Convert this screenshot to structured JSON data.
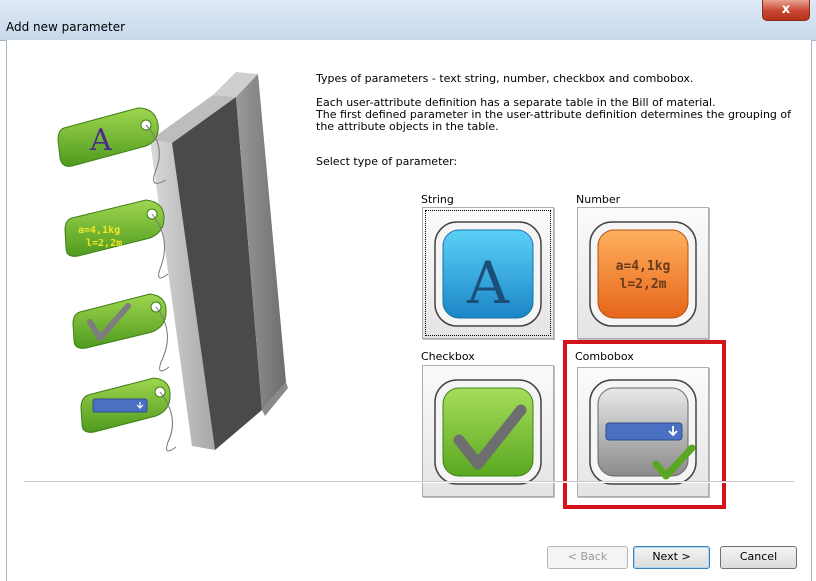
{
  "window": {
    "title": "Add new parameter",
    "close_label": "x"
  },
  "description": {
    "line1": "Types of parameters - text string, number, checkbox and combobox.",
    "line2": "Each user-attribute definition has a separate table in the Bill of material.",
    "line3": "The first defined parameter in the user-attribute definition determines the grouping of",
    "line4": "the attribute objects in the table.",
    "select_prompt": "Select type of parameter:"
  },
  "options": [
    {
      "label": "String",
      "icon": "A",
      "selected": false
    },
    {
      "label": "Number",
      "icon_line1": "a=4,1kg",
      "icon_line2": "l=2,2m",
      "selected": false
    },
    {
      "label": "Checkbox",
      "selected": false
    },
    {
      "label": "Combobox",
      "selected": true
    }
  ],
  "tags": {
    "letter": "A",
    "number_line1": "a=4,1kg",
    "number_line2": "l=2,2m"
  },
  "buttons": {
    "back": "< Back",
    "next": "Next >",
    "cancel": "Cancel"
  },
  "colors": {
    "highlight": "#d3141b",
    "tag_green": "#6cb52d",
    "string_blue": "#2aa6e0",
    "number_orange": "#f07a22",
    "check_green": "#7cc33a"
  }
}
